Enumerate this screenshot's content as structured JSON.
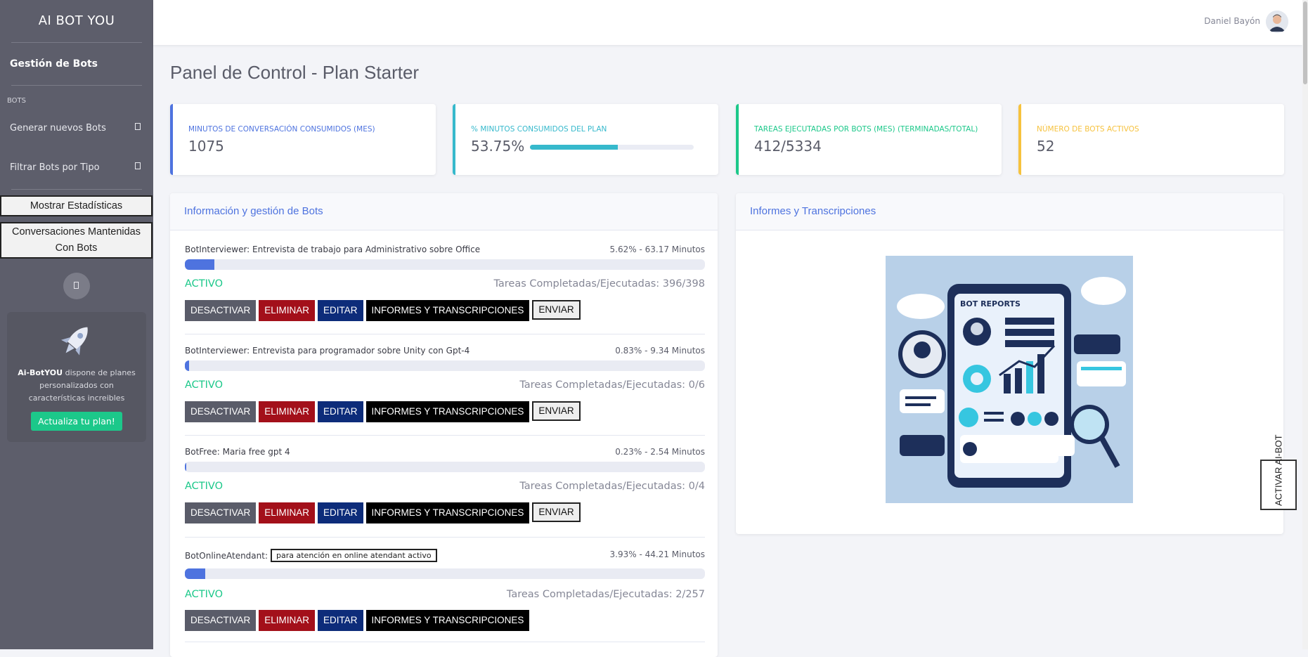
{
  "sidebar": {
    "brand": "AI BOT YOU",
    "top_link": "Gestión de Bots",
    "heading": "BOTS",
    "items": [
      {
        "label": "Generar nuevos Bots"
      },
      {
        "label": "Filtrar Bots por Tipo"
      }
    ],
    "buttons": [
      "Mostrar Estadísticas",
      "Conversaciones Mantenidas Con Bots"
    ],
    "promo": {
      "brand": "Ai-BotYOU",
      "text": "dispone de planes personalizados con características increibles",
      "cta": "Actualiza tu plan!"
    }
  },
  "topbar": {
    "user_name": "Daniel Bayón"
  },
  "page_title": "Panel de Control - Plan Starter",
  "stats": [
    {
      "label": "Minutos de conversación consumidos (mes)",
      "value": "1075"
    },
    {
      "label": "% Minutos consumidos del plan",
      "value": "53.75%",
      "progress": 0.5375
    },
    {
      "label": "Tareas ejecutadas por bots (mes) (Terminadas/Total)",
      "value": "412/5334"
    },
    {
      "label": "Número de bots activos",
      "value": "52"
    }
  ],
  "bots_card": {
    "title": "Información y gestión de Bots",
    "buttons": {
      "deactivate": "DESACTIVAR",
      "delete": "ELIMINAR",
      "edit": "EDITAR",
      "reports": "INFORMES Y TRANSCRIPCIONES",
      "send": "ENVIAR"
    },
    "bots": [
      {
        "title": "BotInterviewer: Entrevista de trabajo para Administrativo sobre Office",
        "meta": "5.62% - 63.17 Minutos",
        "progress": 0.0562,
        "status": "ACTIVO",
        "tasks": "Tareas Completadas/Ejecutadas: 396/398"
      },
      {
        "title": "BotInterviewer: Entrevista para programador sobre Unity con Gpt-4",
        "meta": "0.83% - 9.34 Minutos",
        "progress": 0.0083,
        "status": "ACTIVO",
        "tasks": "Tareas Completadas/Ejecutadas: 0/6"
      },
      {
        "title": "BotFree: Maria free gpt 4",
        "meta": "0.23% - 2.54 Minutos",
        "progress": 0.0023,
        "status": "ACTIVO",
        "tasks": "Tareas Completadas/Ejecutadas: 0/4"
      },
      {
        "title": "BotOnlineAtendant:",
        "tooltip": "para atención en online atendant activo",
        "meta": "3.93% - 44.21 Minutos",
        "progress": 0.0393,
        "status": "ACTIVO",
        "tasks": "Tareas Completadas/Ejecutadas: 2/257"
      }
    ]
  },
  "reports_card": {
    "title": "Informes y Transcripciones",
    "image_text": "BOT REPORTS"
  },
  "float_button": "ACTIVAR AI-BOT",
  "colors": {
    "primary": "#4e73df",
    "info": "#36b9cc",
    "success": "#1cc88a",
    "warning": "#f6c23e",
    "sidebar": "#5d5e6b"
  }
}
